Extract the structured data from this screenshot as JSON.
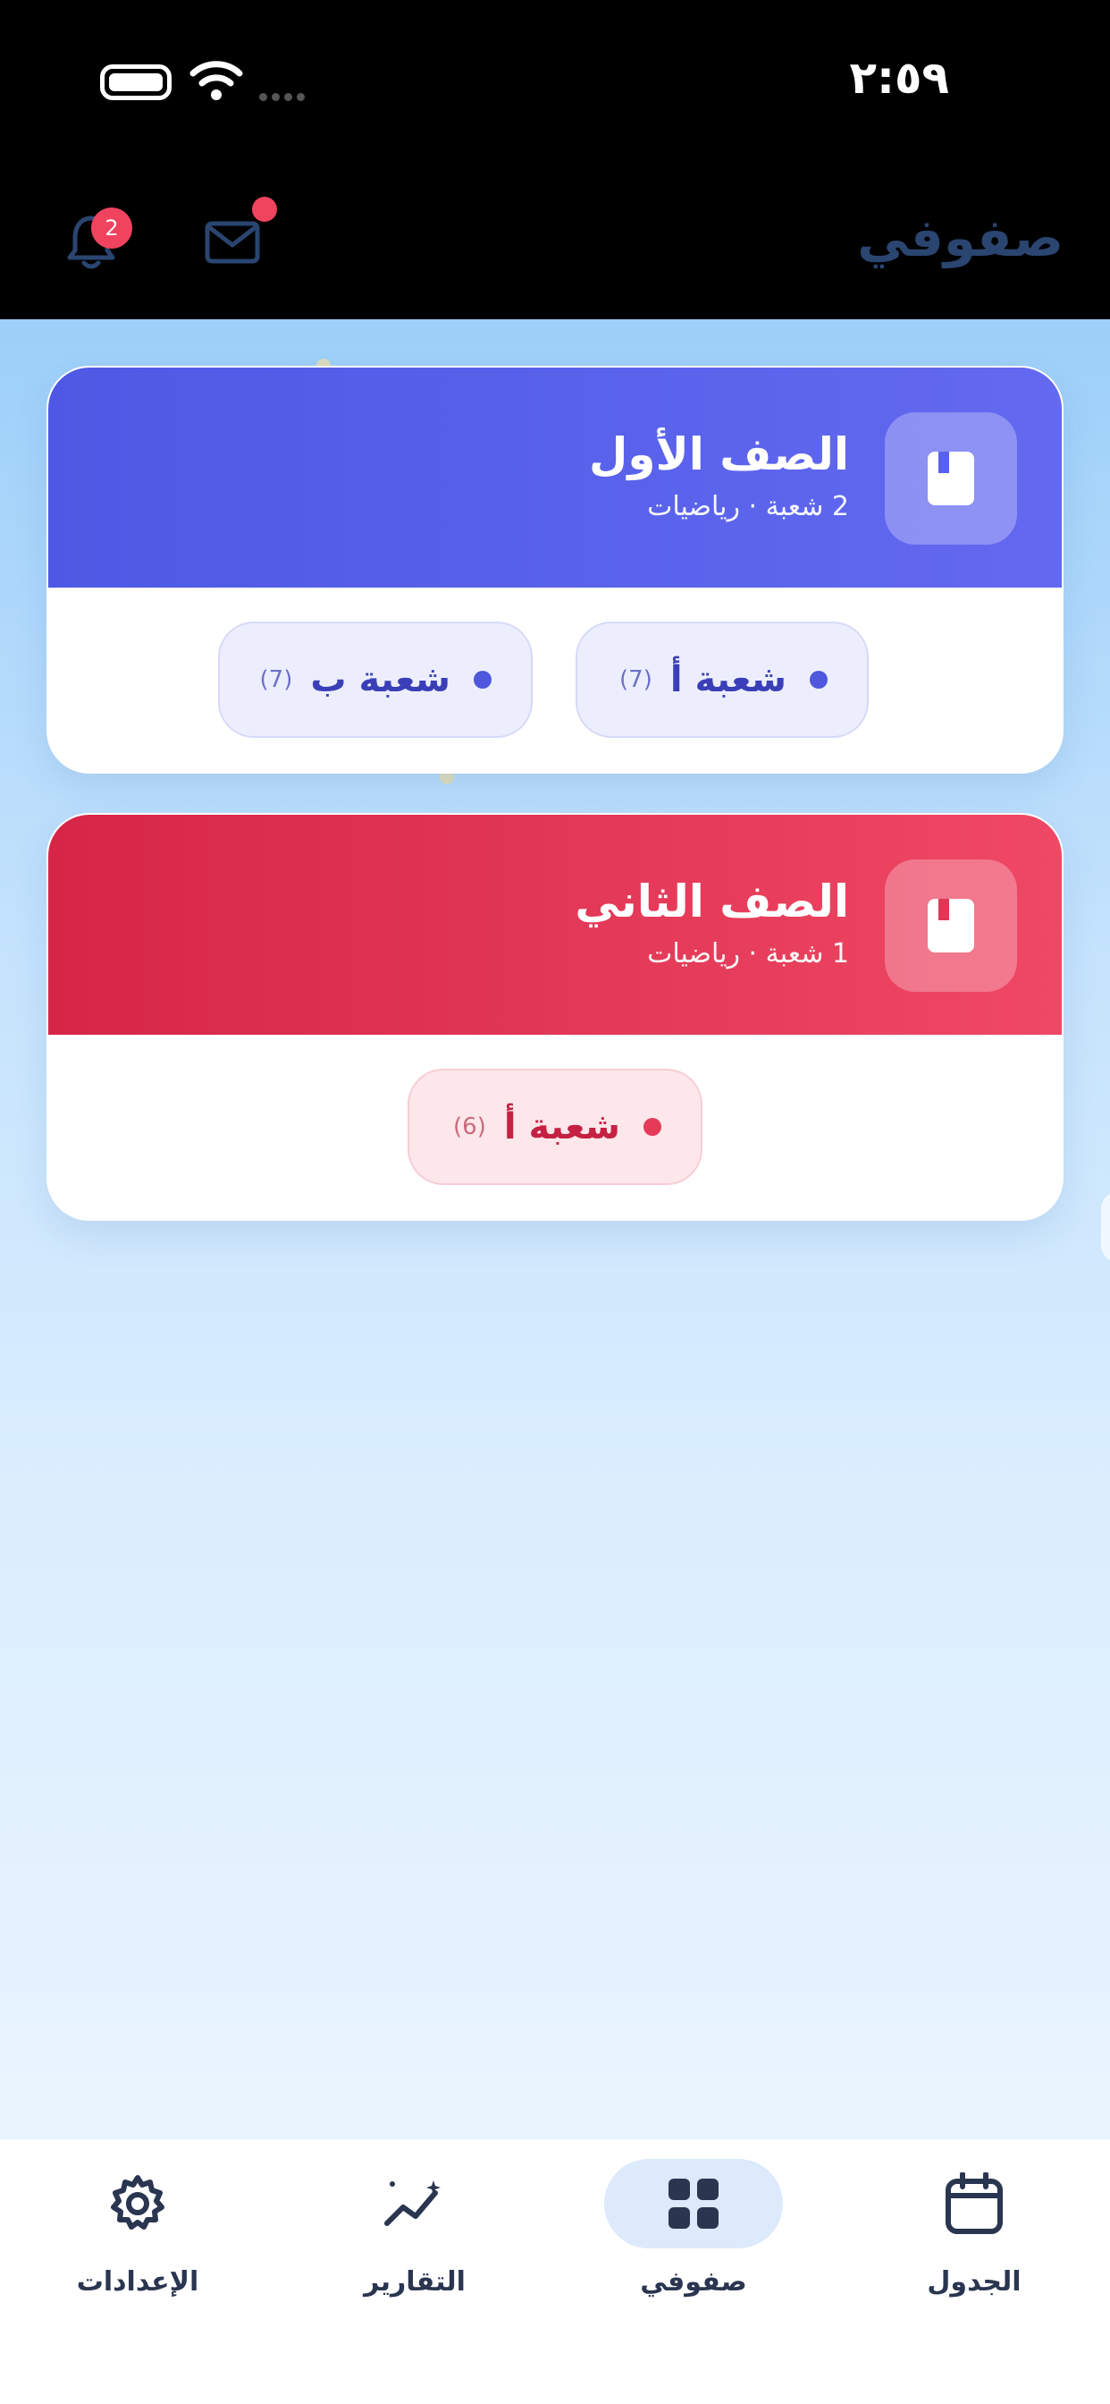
{
  "status_bar": {
    "time": "٢:٥٩"
  },
  "header": {
    "title": "صفوفي",
    "notifications_badge": "2",
    "icons": {
      "notifications": "bell-icon",
      "messages": "mail-icon"
    }
  },
  "classes": [
    {
      "title": "الصف الأول",
      "subtitle": "2 شعبة · رياضيات",
      "color": "#5a62ec",
      "icon": "book-icon",
      "sections": [
        {
          "label": "شعبة أ",
          "count": "(7)"
        },
        {
          "label": "شعبة ب",
          "count": "(7)"
        }
      ]
    },
    {
      "title": "الصف الثاني",
      "subtitle": "1 شعبة · رياضيات",
      "color": "#e23657",
      "icon": "book-icon",
      "sections": [
        {
          "label": "شعبة أ",
          "count": "(6)"
        }
      ]
    }
  ],
  "tabbar": {
    "tabs": [
      {
        "label": "الجدول",
        "icon": "calendar-icon"
      },
      {
        "label": "صفوفي",
        "icon": "grid-icon",
        "active": true
      },
      {
        "label": "التقارير",
        "icon": "chart-icon"
      },
      {
        "label": "الإعدادات",
        "icon": "gear-icon"
      }
    ]
  }
}
